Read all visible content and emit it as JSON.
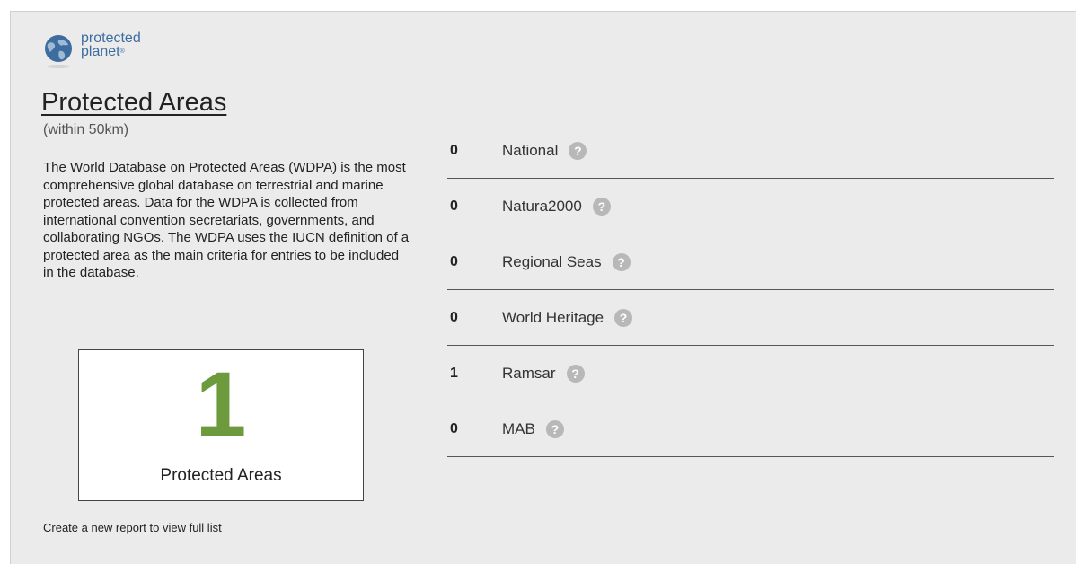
{
  "logo": {
    "line1": "protected",
    "line2": "planet",
    "mark": "®",
    "icon": "globe-icon"
  },
  "header": {
    "title": "Protected Areas",
    "subtitle": "(within 50km)"
  },
  "description": "The World Database on Protected Areas (WDPA) is the most comprehensive global database on terrestrial and marine protected areas. Data for the WDPA is collected from international convention secretariats, governments, and collaborating NGOs. The WDPA uses the IUCN definition of a protected area as the main criteria for entries to be included in the database.",
  "summary": {
    "count": "1",
    "label": "Protected Areas"
  },
  "footer": {
    "link": "Create a new report to view full list"
  },
  "categories": [
    {
      "count": "0",
      "label": "National",
      "help": "?"
    },
    {
      "count": "0",
      "label": "Natura2000",
      "help": "?"
    },
    {
      "count": "0",
      "label": "Regional Seas",
      "help": "?"
    },
    {
      "count": "0",
      "label": "World Heritage",
      "help": "?"
    },
    {
      "count": "1",
      "label": "Ramsar",
      "help": "?"
    },
    {
      "count": "0",
      "label": "MAB",
      "help": "?"
    }
  ],
  "colors": {
    "panel_background": "#ebebeb",
    "logo_blue": "#3d6d9e",
    "count_green": "#6d9a3c",
    "help_icon_grey": "#b8b8b8",
    "divider": "#555555"
  }
}
